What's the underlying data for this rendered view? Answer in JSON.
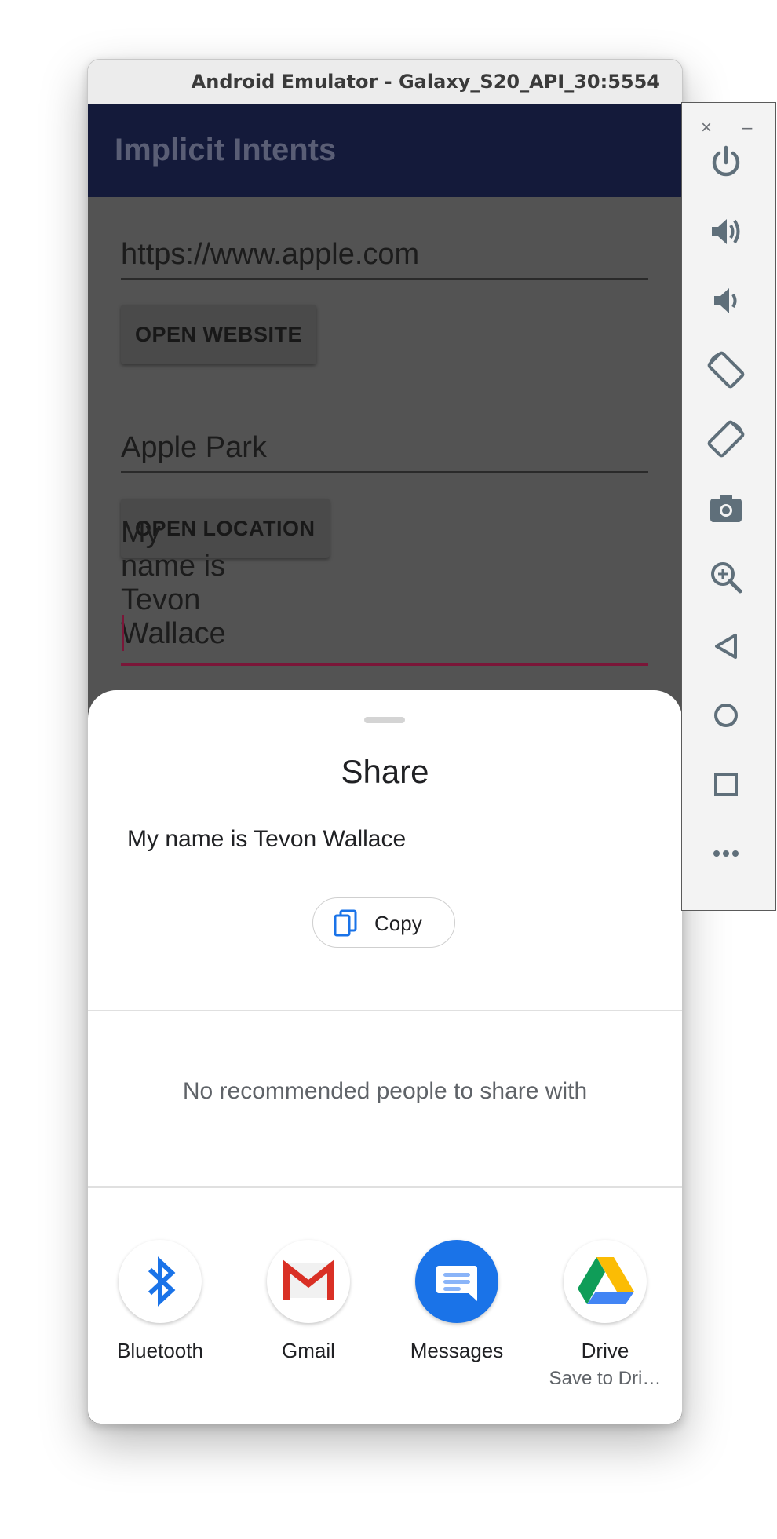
{
  "window": {
    "title": "Android Emulator - Galaxy_S20_API_30:5554"
  },
  "app": {
    "title": "Implicit Intents"
  },
  "form": {
    "website_value": "https://www.apple.com",
    "website_button": "OPEN WEBSITE",
    "location_value": "Apple Park",
    "location_button": "OPEN LOCATION",
    "share_value": "My name is Tevon Wallace"
  },
  "share_sheet": {
    "title": "Share",
    "text": "My name is Tevon Wallace",
    "copy_label": "Copy",
    "no_recommendations": "No recommended people to share with",
    "targets": [
      {
        "label": "Bluetooth",
        "icon": "bluetooth-icon"
      },
      {
        "label": "Gmail",
        "icon": "gmail-icon"
      },
      {
        "label": "Messages",
        "icon": "messages-icon"
      },
      {
        "label": "Drive",
        "sublabel": "Save to Dri…",
        "icon": "drive-icon"
      }
    ]
  },
  "emulator_controls": {
    "close": "×",
    "minimize": "–",
    "items": [
      "power",
      "volume-up",
      "volume-down",
      "rotate-left",
      "rotate-right",
      "camera",
      "zoom",
      "back",
      "home",
      "overview",
      "more"
    ]
  },
  "colors": {
    "app_bar": "#141a3a",
    "scrim": "#535353",
    "accent": "#7a1638",
    "icon_blue": "#1a73e8"
  }
}
